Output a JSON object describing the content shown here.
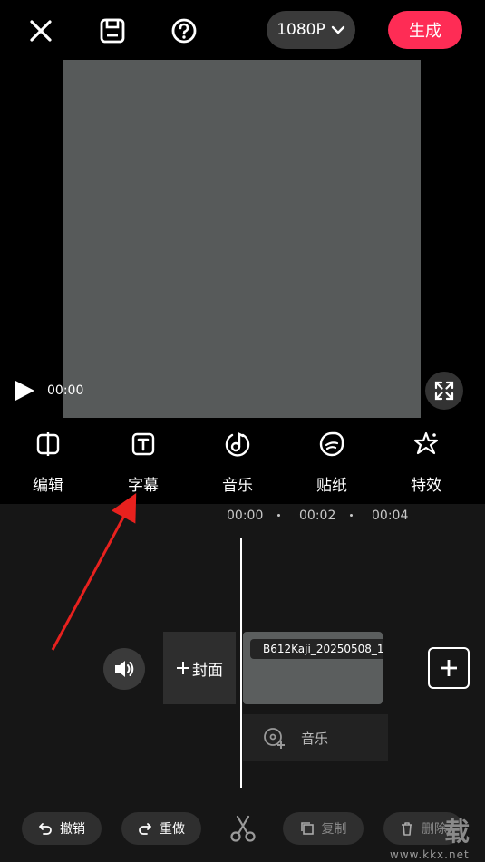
{
  "topbar": {
    "close_icon": "close-icon",
    "save_icon": "save-draft-icon",
    "help_icon": "help-icon",
    "resolution": "1080P",
    "generate_label": "生成"
  },
  "player": {
    "current_time": "00:00"
  },
  "tools": [
    {
      "label": "编辑",
      "icon": "edit-icon"
    },
    {
      "label": "字幕",
      "icon": "text-icon"
    },
    {
      "label": "音乐",
      "icon": "music-icon"
    },
    {
      "label": "贴纸",
      "icon": "sticker-icon"
    },
    {
      "label": "特效",
      "icon": "effects-icon"
    }
  ],
  "timeline": {
    "ruler": [
      "00:00",
      "00:02",
      "00:04"
    ],
    "cover_label": "封面",
    "clip_name": "B612Kaji_20250508_1",
    "music_label": "音乐"
  },
  "bottombar": {
    "undo_label": "撤销",
    "redo_label": "重做",
    "copy_label": "复制",
    "delete_label": "删除"
  },
  "watermark": {
    "text": "www.kkx.net",
    "char": "载"
  },
  "colors": {
    "accent": "#fe2c55",
    "annotation_arrow": "#e8211e",
    "preview": "#575a5a"
  }
}
